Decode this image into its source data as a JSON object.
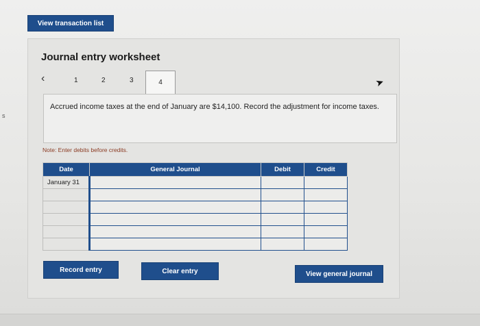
{
  "header": {
    "view_transaction_list_label": "View transaction list"
  },
  "worksheet": {
    "title": "Journal entry worksheet",
    "pages": [
      "1",
      "2",
      "3",
      "4"
    ],
    "active_page": "4",
    "prompt": "Accrued income taxes at the end of January are $14,100. Record the adjustment for income taxes.",
    "note": "Note: Enter debits before credits."
  },
  "table": {
    "columns": [
      "Date",
      "General Journal",
      "Debit",
      "Credit"
    ],
    "rows": [
      {
        "date": "January 31",
        "account": "",
        "debit": "",
        "credit": ""
      },
      {
        "date": "",
        "account": "",
        "debit": "",
        "credit": ""
      },
      {
        "date": "",
        "account": "",
        "debit": "",
        "credit": ""
      },
      {
        "date": "",
        "account": "",
        "debit": "",
        "credit": ""
      },
      {
        "date": "",
        "account": "",
        "debit": "",
        "credit": ""
      },
      {
        "date": "",
        "account": "",
        "debit": "",
        "credit": ""
      }
    ]
  },
  "actions": {
    "record_label": "Record entry",
    "clear_label": "Clear entry",
    "view_general_journal_label": "View general journal"
  },
  "edge_glyph": "s",
  "colors": {
    "button_blue": "#1f4e8c",
    "note_text": "#8a3a22"
  }
}
